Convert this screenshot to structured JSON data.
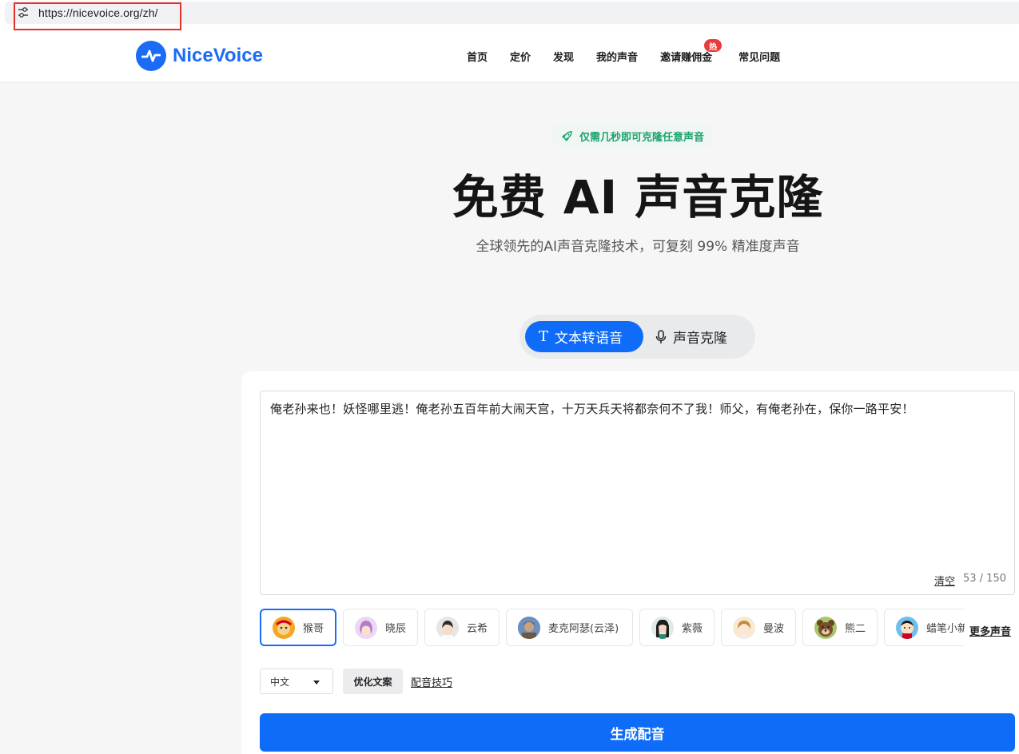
{
  "browser": {
    "url": "https://nicevoice.org/zh/"
  },
  "header": {
    "logo_text": "NiceVoice",
    "nav": [
      {
        "label": "首页"
      },
      {
        "label": "定价"
      },
      {
        "label": "发现"
      },
      {
        "label": "我的声音"
      },
      {
        "label": "邀请赚佣金",
        "badge": "热"
      },
      {
        "label": "常见问题"
      }
    ]
  },
  "hero": {
    "tag": "仅需几秒即可克隆任意声音",
    "title": "免费 AI 声音克隆",
    "subtitle": "全球领先的AI声音克隆技术，可复刻 99% 精准度声音"
  },
  "tabs": [
    {
      "label": "文本转语音",
      "icon": "text-icon",
      "active": true
    },
    {
      "label": "声音克隆",
      "icon": "microphone-icon",
      "active": false
    }
  ],
  "editor": {
    "text": "俺老孙来也！妖怪哪里逃！俺老孙五百年前大闹天宫，十万天兵天将都奈何不了我！师父，有俺老孙在，保你一路平安！",
    "clear_label": "清空",
    "char_count": "53 / 150"
  },
  "voices": [
    {
      "name": "猴哥",
      "selected": true,
      "color": "#f5a623"
    },
    {
      "name": "晓辰",
      "selected": false,
      "color": "#d9a7e0"
    },
    {
      "name": "云希",
      "selected": false,
      "color": "#d7d7d7"
    },
    {
      "name": "麦克阿瑟(云泽)",
      "selected": false,
      "color": "#7a6a4e"
    },
    {
      "name": "紫薇",
      "selected": false,
      "color": "#3b3b3b"
    },
    {
      "name": "曼波",
      "selected": false,
      "color": "#f2cf8a"
    },
    {
      "name": "熊二",
      "selected": false,
      "color": "#7b9a3f"
    },
    {
      "name": "蜡笔小新",
      "selected": false,
      "color": "#3ba3e8"
    }
  ],
  "more_voices_label": "更多声音",
  "controls": {
    "language": "中文",
    "optimize_label": "优化文案",
    "tips_label": "配音技巧"
  },
  "generate_label": "生成配音",
  "colors": {
    "brand": "#0f6cf9",
    "hot_badge": "#ec3a3a",
    "tag_green": "#1aa36b"
  }
}
